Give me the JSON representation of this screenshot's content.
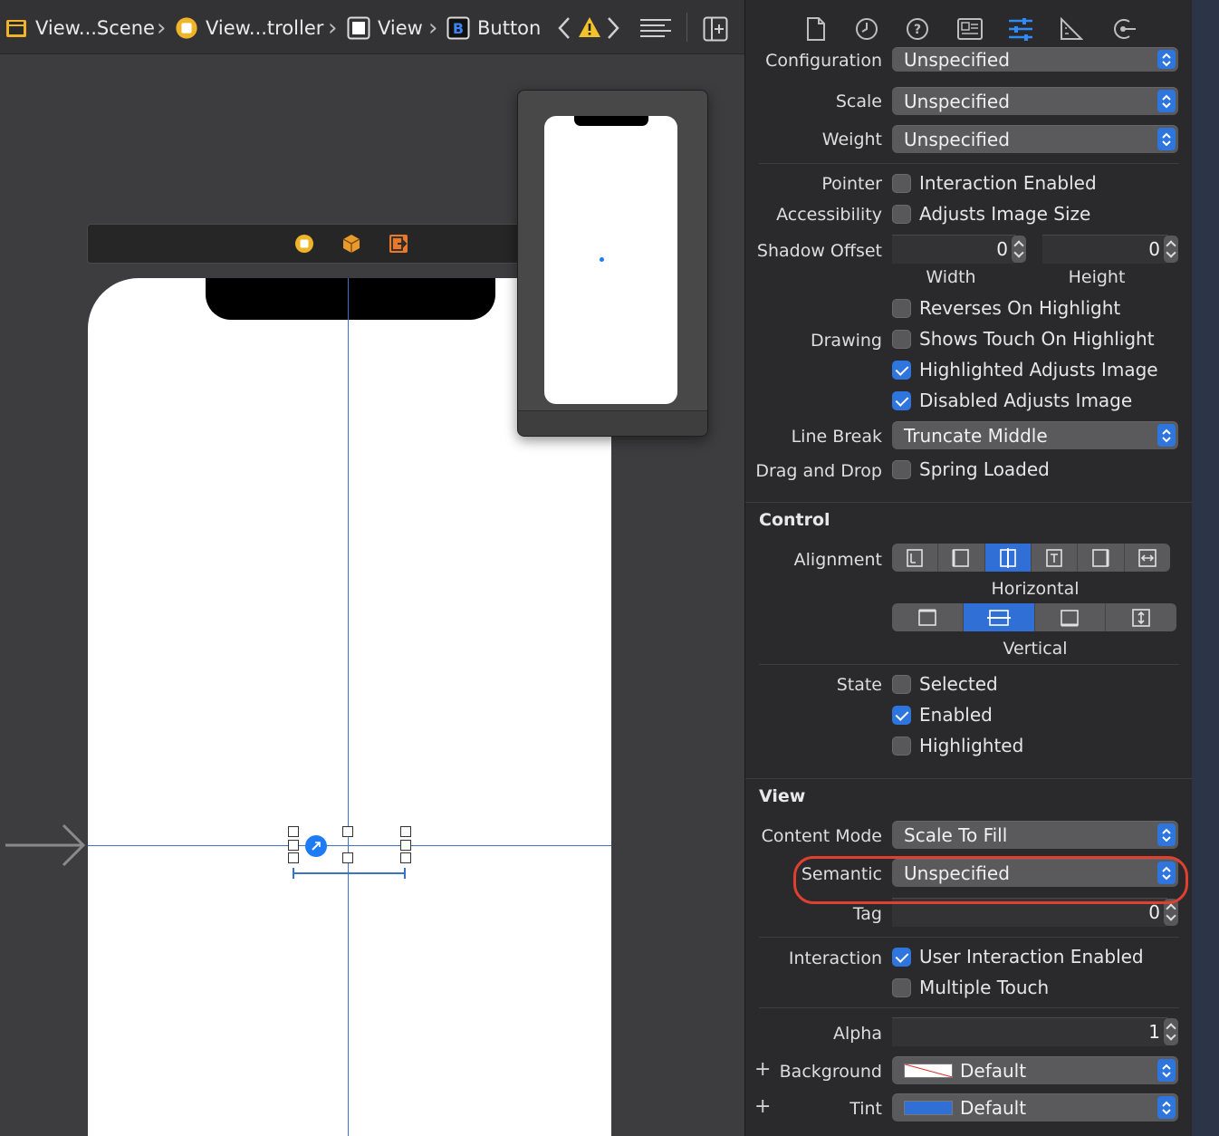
{
  "jumpbar": {
    "items": [
      "View...Scene",
      "View...troller",
      "View",
      "Button"
    ],
    "icons": [
      "storyboard-icon",
      "view-controller-icon",
      "view-icon",
      "button-icon",
      "warning-icon",
      "editor-options-icon",
      "add-editor-icon"
    ]
  },
  "canvas": {
    "dock_icons": [
      "view-controller-icon",
      "first-responder-icon",
      "exit-icon"
    ]
  },
  "inspector": {
    "tabs": [
      "file-icon",
      "history-icon",
      "help-icon",
      "identity-icon",
      "attributes-icon",
      "size-icon",
      "connections-icon"
    ],
    "configuration": {
      "label": "Configuration",
      "value": "Unspecified"
    },
    "scale": {
      "label": "Scale",
      "value": "Unspecified"
    },
    "weight": {
      "label": "Weight",
      "value": "Unspecified"
    },
    "pointer": {
      "label": "Pointer",
      "option": "Interaction Enabled",
      "checked": false
    },
    "accessibility": {
      "label": "Accessibility",
      "option": "Adjusts Image Size",
      "checked": false
    },
    "shadow_offset": {
      "label": "Shadow Offset",
      "width": "0",
      "height": "0",
      "width_label": "Width",
      "height_label": "Height"
    },
    "reverses": {
      "option": "Reverses On Highlight",
      "checked": false
    },
    "drawing": {
      "label": "Drawing",
      "options": [
        {
          "text": "Shows Touch On Highlight",
          "checked": false
        },
        {
          "text": "Highlighted Adjusts Image",
          "checked": true
        },
        {
          "text": "Disabled Adjusts Image",
          "checked": true
        }
      ]
    },
    "line_break": {
      "label": "Line Break",
      "value": "Truncate Middle"
    },
    "drag_drop": {
      "label": "Drag and Drop",
      "option": "Spring Loaded",
      "checked": false
    },
    "control": {
      "title": "Control",
      "alignment_label": "Alignment",
      "horizontal_label": "Horizontal",
      "vertical_label": "Vertical",
      "horizontal_selected": 2,
      "vertical_selected": 1,
      "state_label": "State",
      "states": [
        {
          "text": "Selected",
          "checked": false
        },
        {
          "text": "Enabled",
          "checked": true
        },
        {
          "text": "Highlighted",
          "checked": false
        }
      ]
    },
    "view": {
      "title": "View",
      "content_mode": {
        "label": "Content Mode",
        "value": "Scale To Fill"
      },
      "semantic": {
        "label": "Semantic",
        "value": "Unspecified"
      },
      "tag": {
        "label": "Tag",
        "value": "0"
      },
      "interaction_label": "Interaction",
      "interaction": [
        {
          "text": "User Interaction Enabled",
          "checked": true
        },
        {
          "text": "Multiple Touch",
          "checked": false
        }
      ],
      "alpha": {
        "label": "Alpha",
        "value": "1"
      },
      "background": {
        "label": "Background",
        "value": "Default"
      },
      "tint": {
        "label": "Tint",
        "value": "Default",
        "color": "#2f6fd6"
      }
    }
  },
  "colors": {
    "accent": "#2f75de",
    "highlight_ring": "#e0412f",
    "guide": "#3a74c9"
  }
}
